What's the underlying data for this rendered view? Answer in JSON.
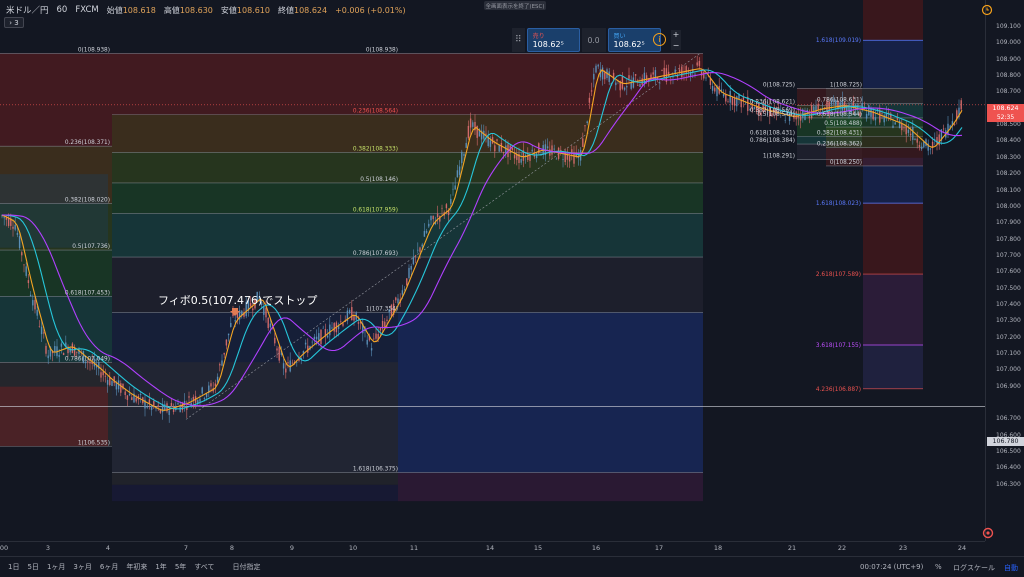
{
  "header": {
    "symbol": "米ドル／円",
    "interval": "60",
    "source": "FXCM",
    "open_label": "始値",
    "open_value": "108.618",
    "high_label": "高値",
    "high_value": "108.630",
    "low_label": "安値",
    "low_value": "108.610",
    "close_label": "終値",
    "close_value": "108.624",
    "change": "+0.006 (+0.01%)",
    "collapse_label": "› 3",
    "fullscreen_exit": "全画面表示を終了(ESC)"
  },
  "trade_panel": {
    "sell_label": "売り",
    "sell_price": "108.62⁵",
    "spread": "0.0",
    "buy_label": "買い",
    "buy_price": "108.62⁵",
    "info_icon": "info-icon",
    "plus": "+",
    "minus": "−"
  },
  "annotation": "フィボ0.5(107.476)でストップ",
  "price_axis": {
    "ticks": [
      "109.100",
      "109.000",
      "108.900",
      "108.800",
      "108.700",
      "108.600",
      "108.500",
      "108.400",
      "108.300",
      "108.200",
      "108.100",
      "108.000",
      "107.900",
      "107.800",
      "107.700",
      "107.600",
      "107.500",
      "107.400",
      "107.300",
      "107.200",
      "107.100",
      "107.000",
      "106.900",
      "106.700",
      "106.600",
      "106.500",
      "106.400",
      "106.300"
    ],
    "current_price": "108.624",
    "countdown": "52:35",
    "line_price": "106.780",
    "alert_icon": "clock-alert-icon",
    "settings_icon": "settings-icon"
  },
  "time_axis": {
    "ticks": [
      "00",
      "3",
      "4",
      "7",
      "8",
      "9",
      "10",
      "11",
      "14",
      "15",
      "16",
      "17",
      "18",
      "21",
      "22",
      "23",
      "24"
    ]
  },
  "fib_left": [
    "0(108.938)",
    "0.236(108.371)",
    "0.382(108.020)",
    "0.5(107.736)",
    "0.618(107.453)",
    "0.786(107.049)",
    "1(106.535)"
  ],
  "fib_mid": [
    "0(108.938)",
    "0.236(108.564)",
    "0.382(108.333)",
    "0.5(108.146)",
    "0.618(107.959)",
    "0.786(107.693)",
    "1(107.354)",
    "1.618(106.375)"
  ],
  "fib_right_ext": [
    "1.618(109.019)",
    "1.618(108.023)",
    "2.618(107.589)",
    "3.618(107.155)",
    "4.236(106.887)"
  ],
  "fib_right": [
    "0(108.725)",
    "0.236(108.621)",
    "0.382(108.569)",
    "0.5(108.544)",
    "0.618(108.431)",
    "0.786(108.384)",
    "1(108.291)"
  ],
  "fib_right2": [
    "1(108.725)",
    "0.786(108.631)",
    "0.618(108.544)",
    "0.5(108.488)",
    "0.382(108.431)",
    "0.236(108.362)",
    "0(108.250)"
  ],
  "bottom_bar": {
    "ranges": [
      "1日",
      "5日",
      "1ヶ月",
      "3ヶ月",
      "6ヶ月",
      "年初来",
      "1年",
      "5年",
      "すべて"
    ],
    "goto_date": "日付指定",
    "clock": "00:07:24 (UTC+9)",
    "percent": "%",
    "log_scale": "ログスケール",
    "auto": "自動"
  },
  "colors": {
    "background": "#131722",
    "sell": "#ef5350",
    "buy": "#42a5f5",
    "price_tag": "#ef5350",
    "ma_fast": "#f5a623",
    "ma_mid": "#26c6da",
    "ma_slow": "#b040ff"
  }
}
